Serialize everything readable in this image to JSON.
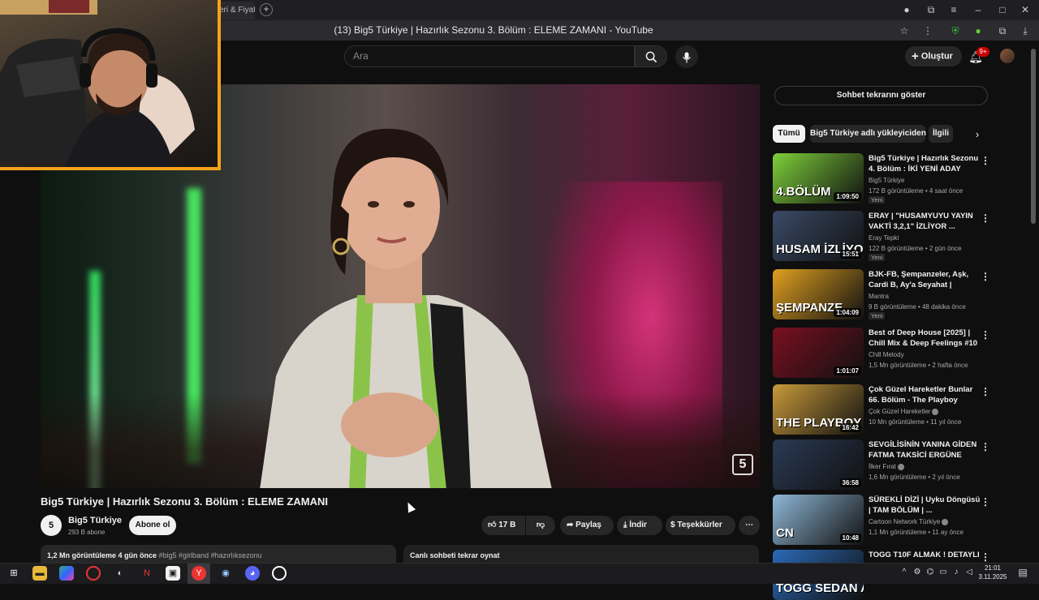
{
  "browser": {
    "tab_partial": "eri & Fiyat",
    "page_title": "(13) Big5 Türkiye | Hazırlık Sezonu 3. Bölüm : ELEME ZAMANI - YouTube"
  },
  "masthead": {
    "search_placeholder": "Ara",
    "create_label": "Oluştur",
    "notifications_badge": "9+"
  },
  "video": {
    "title": "Big5 Türkiye | Hazırlık Sezonu 3. Bölüm : ELEME ZAMANI",
    "channel_name": "Big5 Türkiye",
    "subscribers": "293 B abone",
    "subscribe_label": "Abone ol",
    "likes": "17 B",
    "share_label": "Paylaş",
    "download_label": "İndir",
    "thanks_label": "Teşekkürler",
    "views_date": "1,2 Mn görüntüleme  4 gün önce",
    "tags": "#big5 #girlband #hazırlıksezonu",
    "chat_replay_label": "Canlı sohbeti tekrar oynat",
    "watermark_logo": "5"
  },
  "sidebar": {
    "show_chat_label": "Sohbet tekrarını göster",
    "chips": [
      "Tümü",
      "Big5 Türkiye adlı yükleyiciden",
      "İlgili"
    ],
    "recommendations": [
      {
        "title": "Big5 Türkiye | Hazırlık Sezonu 4. Bölüm : İKİ YENİ ADAY",
        "channel": "Big5 Türkiye",
        "stats": "172 B görüntüleme • 4 saat önce",
        "badge": "Yeni",
        "duration": "1:09:50",
        "thumb_text": "4.BÖLÜM",
        "color": "#7fcf3a"
      },
      {
        "title": "ERAY | \"HUSAMYUYU YAYIN VAKTİ 3,2,1\" İZLİYOR ...",
        "channel": "Eray Tepki",
        "stats": "122 B görüntüleme • 2 gün önce",
        "badge": "Yeni",
        "duration": "15:51",
        "thumb_text": "HUSAM İZLİYOR",
        "color": "#3a4a66"
      },
      {
        "title": "BJK-FB, Şempanzeler, Aşk, Cardi B, Ay'a Seyahat | Harman...",
        "channel": "Mantra",
        "stats": "9 B görüntüleme • 48 dakika önce",
        "badge": "Yeni",
        "duration": "1:04:09",
        "thumb_text": "ŞEMPANZE",
        "color": "#e0a020"
      },
      {
        "title": "Best of Deep House [2025] | Chill Mix & Deep Feelings #10",
        "channel": "Chill Melody",
        "stats": "1,5 Mn görüntüleme • 2 hafta önce",
        "badge": "",
        "duration": "1:01:07",
        "thumb_text": "",
        "color": "#7a1020"
      },
      {
        "title": "Çok Güzel Hareketler Bunlar 66. Bölüm - The Playboy",
        "channel": "Çok Güzel Hareketler",
        "stats": "10 Mn görüntüleme • 11 yıl önce",
        "badge": "",
        "duration": "16:42",
        "thumb_text": "THE PLAYBOY",
        "color": "#c89a3a"
      },
      {
        "title": "SEVGİLİSİNİN YANINA GİDEN FATMA TAKSİCİ ERGÜNE ASIK...",
        "channel": "İlker Fırat",
        "stats": "1,6 Mn görüntüleme • 2 yıl önce",
        "badge": "",
        "duration": "36:58",
        "thumb_text": "",
        "color": "#2a3a55"
      },
      {
        "title": "SÜREKLİ DİZİ | Uyku Döngüsü | TAM BÖLÜM | ...",
        "channel": "Cartoon Network Türkiye",
        "stats": "1,1 Mn görüntüleme • 11 ay önce",
        "badge": "",
        "duration": "10:48",
        "thumb_text": "CN",
        "color": "#8fb8d8"
      },
      {
        "title": "TOGG T10F ALMAK ! DETAYLI",
        "channel": "",
        "stats": "",
        "badge": "",
        "duration": "",
        "thumb_text": "TOGG SEDAN ALMAK!",
        "color": "#2a6ab8"
      }
    ]
  },
  "taskbar": {
    "time": "21:01",
    "date": "3.11.2025"
  },
  "colors": {
    "background": "#0f0f0f",
    "webcam_border": "#f7a21b",
    "notification_red": "#cc0000",
    "chip_active": "#f1f1f1"
  }
}
